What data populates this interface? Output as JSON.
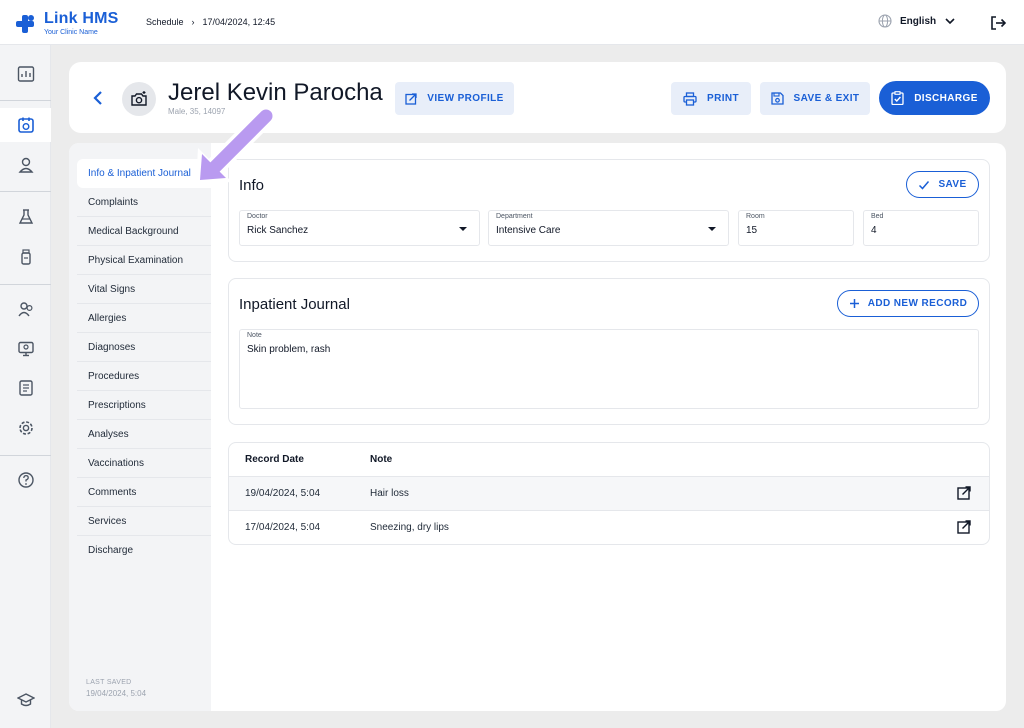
{
  "app": {
    "name": "Link HMS",
    "tagline": "Your Clinic Name"
  },
  "breadcrumb": {
    "section": "Schedule",
    "separator": "›",
    "datetime": "17/04/2024, 12:45"
  },
  "language": {
    "selected": "English"
  },
  "rail": {
    "icons": [
      "dashboard-icon",
      "calendar-icon",
      "patient-icon",
      "lab-flask-icon",
      "medicine-bottle-icon",
      "users-icon",
      "monitor-icon",
      "report-icon",
      "settings-icon",
      "help-icon",
      "education-icon"
    ],
    "active": "calendar-icon"
  },
  "patient": {
    "name": "Jerel Kevin Parocha",
    "meta": "Male, 35, 14097"
  },
  "actions": {
    "view_profile": "VIEW PROFILE",
    "print": "PRINT",
    "save_exit": "SAVE & EXIT",
    "discharge": "DISCHARGE"
  },
  "subnav": {
    "items": [
      "Info & Inpatient Journal",
      "Complaints",
      "Medical Background",
      "Physical Examination",
      "Vital Signs",
      "Allergies",
      "Diagnoses",
      "Procedures",
      "Prescriptions",
      "Analyses",
      "Vaccinations",
      "Comments",
      "Services",
      "Discharge"
    ],
    "active_index": 0,
    "last_saved_label": "LAST SAVED",
    "last_saved_value": "19/04/2024, 5:04"
  },
  "info": {
    "title": "Info",
    "save_label": "SAVE",
    "doctor": {
      "label": "Doctor",
      "value": "Rick Sanchez"
    },
    "department": {
      "label": "Department",
      "value": "Intensive Care"
    },
    "room": {
      "label": "Room",
      "value": "15"
    },
    "bed": {
      "label": "Bed",
      "value": "4"
    }
  },
  "journal": {
    "title": "Inpatient Journal",
    "add_label": "ADD NEW RECORD",
    "note": {
      "label": "Note",
      "value": "Skin problem, rash"
    }
  },
  "records": {
    "columns": [
      "Record Date",
      "Note"
    ],
    "rows": [
      {
        "date": "19/04/2024, 5:04",
        "note": "Hair loss"
      },
      {
        "date": "17/04/2024, 5:04",
        "note": "Sneezing, dry lips"
      }
    ]
  },
  "colors": {
    "accent": "#1a5fd6",
    "annotation": "#b99af0"
  }
}
